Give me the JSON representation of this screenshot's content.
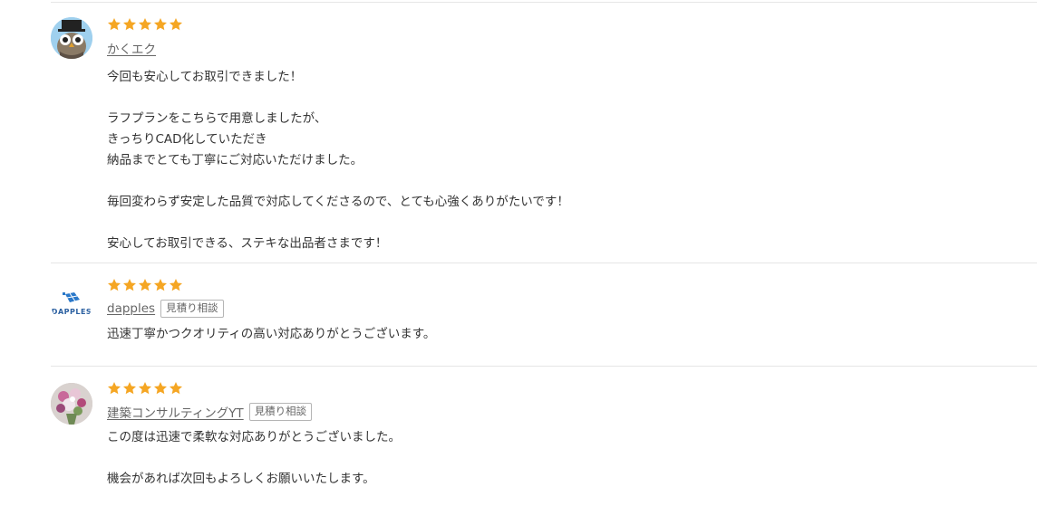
{
  "reviews": [
    {
      "rating": 5,
      "user_name": "かくエク",
      "avatar_icon": "owl-top-hat-icon",
      "badge": "",
      "body_lines": [
        "今回も安心してお取引できました！",
        "",
        "ラフプランをこちらで用意しましたが、",
        "きっちりCAD化していただき",
        "納品までとても丁寧にご対応いただけました。",
        "",
        "毎回変わらず安定した品質で対応してくださるので、とても心強くありがたいです！",
        "",
        "安心してお取引できる、ステキな出品者さまです！"
      ]
    },
    {
      "rating": 5,
      "user_name": "dapples",
      "avatar_icon": "dapples-logo-icon",
      "avatar_text": "DAPPLES",
      "badge": "見積り相談",
      "body_lines": [
        "迅速丁寧かつクオリティの高い対応ありがとうございます。"
      ]
    },
    {
      "rating": 5,
      "user_name": "建築コンサルティングYT",
      "avatar_icon": "flower-bouquet-icon",
      "badge": "見積り相談",
      "body_lines": [
        "この度は迅速で柔軟な対応ありがとうございました。",
        "",
        "機会があれば次回もよろしくお願いいたします。"
      ]
    }
  ],
  "colors": {
    "star": "#f5a623",
    "divider": "#e6e6e6",
    "text": "#333333",
    "muted": "#666666"
  }
}
